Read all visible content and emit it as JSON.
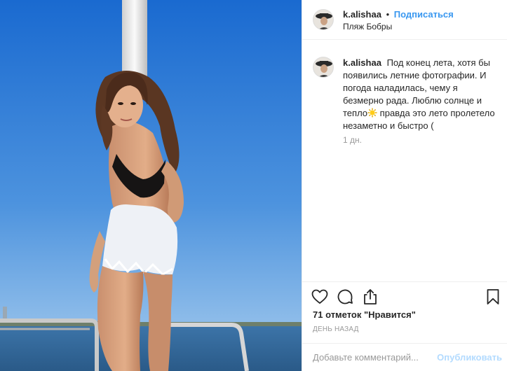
{
  "post": {
    "username": "k.alishaa",
    "dot": "•",
    "follow_label": "Подписаться",
    "location": "Пляж Бобры",
    "caption_text": "Под конец лета, хотя бы появились летние фотографии. И погода наладилась, чему я безмерно рада. Люблю солнце и тепло",
    "caption_tail": "правда это лето пролетело незаметно и быстро (",
    "time_ago": "1 дн.",
    "likes": "71 отметок \"Нравится\"",
    "date": "ДЕНЬ НАЗАД",
    "comment_placeholder": "Добавьте комментарий...",
    "publish_label": "Опубликовать"
  },
  "icons": {
    "like": "heart-icon",
    "comment": "comment-icon",
    "share": "share-icon",
    "save": "bookmark-icon",
    "emoji": "sun-emoji"
  },
  "colors": {
    "link": "#3897f0",
    "publish_disabled": "#b3dbff",
    "muted": "#999999",
    "text": "#262626",
    "sky_top": "#1f6fd1",
    "sky_bottom": "#9fc7ec"
  }
}
